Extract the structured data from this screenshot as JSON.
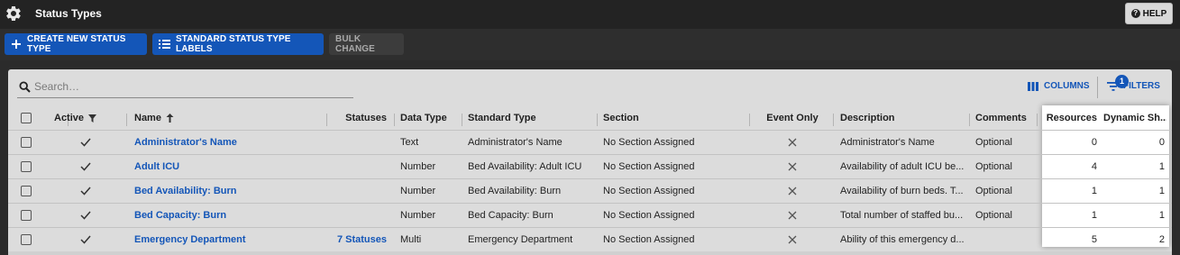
{
  "titlebar": {
    "title": "Status Types",
    "help_label": "HELP",
    "icon": "gear-icon"
  },
  "toolbar": {
    "create_label": "CREATE NEW STATUS TYPE",
    "labels_label": "STANDARD STATUS TYPE LABELS",
    "bulk_label": "BULK CHANGE"
  },
  "search": {
    "placeholder": "Search…",
    "value": ""
  },
  "grid_actions": {
    "columns_label": "COLUMNS",
    "filters_label": "FILTERS",
    "filter_count": "1"
  },
  "columns": {
    "active": "Active",
    "name": "Name",
    "statuses": "Statuses",
    "data_type": "Data Type",
    "standard_type": "Standard Type",
    "section": "Section",
    "event_only": "Event Only",
    "description": "Description",
    "comments": "Comments",
    "resources": "Resources",
    "dynamic": "Dynamic Sh..."
  },
  "rows": [
    {
      "name": "Administrator's Name",
      "statuses": "",
      "data_type": "Text",
      "standard_type": "Administrator's Name",
      "section": "No Section Assigned",
      "description": "Administrator's Name",
      "comments": "Optional",
      "resources": "0",
      "dynamic": "0"
    },
    {
      "name": "Adult ICU",
      "statuses": "",
      "data_type": "Number",
      "standard_type": "Bed Availability: Adult ICU",
      "section": "No Section Assigned",
      "description": "Availability of adult ICU be...",
      "comments": "Optional",
      "resources": "4",
      "dynamic": "1"
    },
    {
      "name": "Bed Availability: Burn",
      "statuses": "",
      "data_type": "Number",
      "standard_type": "Bed Availability: Burn",
      "section": "No Section Assigned",
      "description": "Availability of burn beds. T...",
      "comments": "Optional",
      "resources": "1",
      "dynamic": "1"
    },
    {
      "name": "Bed Capacity: Burn",
      "statuses": "",
      "data_type": "Number",
      "standard_type": "Bed Capacity: Burn",
      "section": "No Section Assigned",
      "description": "Total number of staffed bu...",
      "comments": "Optional",
      "resources": "1",
      "dynamic": "1"
    },
    {
      "name": "Emergency Department",
      "statuses": "7 Statuses",
      "data_type": "Multi",
      "standard_type": "Emergency Department",
      "section": "No Section Assigned",
      "description": "Ability of this emergency d...",
      "comments": "",
      "resources": "5",
      "dynamic": "2"
    }
  ],
  "colors": {
    "accent": "#1456b8",
    "titlebar": "#232323",
    "toolbar": "#2e2e2e",
    "panel": "#dcdcdc"
  }
}
